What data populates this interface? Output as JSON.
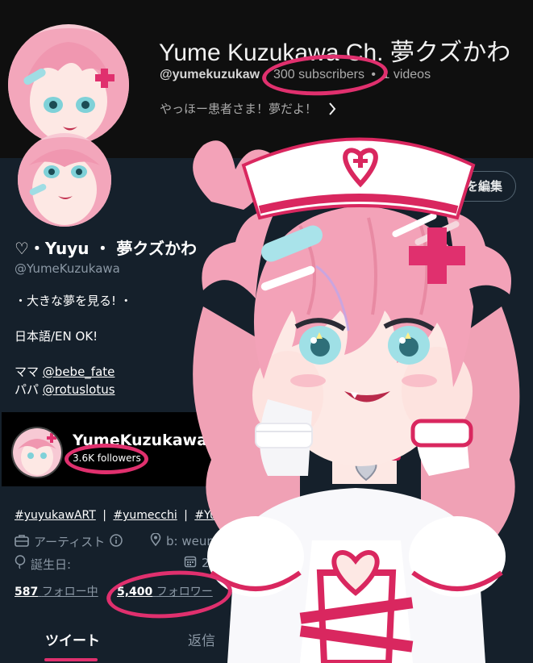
{
  "youtube": {
    "channel_name": "Yume Kuzukawa Ch. 夢クズかわ",
    "handle": "@yumekuzukaw",
    "subscribers": "300 subscribers",
    "separator": "•",
    "videos": "1 videos",
    "description": "やっほー患者さま！夢だよ！"
  },
  "twitter": {
    "edit_button": "ィールを編集",
    "display_name": "♡・Yuyu ・ 夢クズかわ",
    "handle": "@YumeKuzukawa",
    "bio": {
      "line1": "・大きな夢を見る! ・",
      "line2": "日本語/EN OK!",
      "mama_label": "ママ",
      "mama_link": "@bebe_fate",
      "papa_label": "パパ",
      "papa_link": "@rotuslotus"
    },
    "tags": {
      "tag1": "#yuyukawART",
      "tag2": "#yumecchi",
      "tag3": "#Yuyu草",
      "bar": "|"
    },
    "profession": "アーティスト",
    "link": "b: weunta",
    "birthday_label": "誕生日:",
    "joined_partial": "20",
    "following_count": "587",
    "following_label": "フォロー中",
    "followers_count": "5,400",
    "followers_label": "フォロワー",
    "tabs": {
      "tweets": "ツイート",
      "replies": "返信"
    }
  },
  "pixiv": {
    "name": "YumeKuzukawa",
    "followers": "3.6K followers"
  },
  "colors": {
    "highlight": "#e0306e",
    "yt_bg": "#0f0f0f",
    "tw_bg": "#15202b",
    "hair_pink": "#f4a3b8",
    "nurse_pink": "#e0306e"
  },
  "icons": [
    "chevron-right-icon",
    "briefcase-icon",
    "info-icon",
    "location-icon",
    "calendar-icon",
    "cross-hairclip-icon"
  ]
}
